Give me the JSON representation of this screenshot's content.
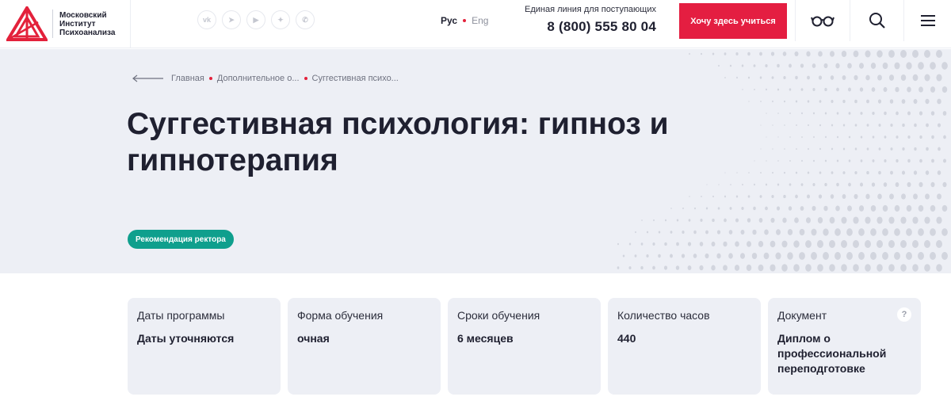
{
  "header": {
    "logo_lines": [
      "Московский",
      "Институт",
      "Психоанализа"
    ],
    "socials": [
      {
        "icon": "vk-icon",
        "glyph": "vk"
      },
      {
        "icon": "telegram-icon",
        "glyph": "➤"
      },
      {
        "icon": "youtube-icon",
        "glyph": "▶"
      },
      {
        "icon": "dzen-icon",
        "glyph": "✦"
      },
      {
        "icon": "whatsapp-icon",
        "glyph": "✆"
      }
    ],
    "lang_active": "Рус",
    "lang_inactive": "Eng",
    "phone_caption": "Единая линия для поступающих",
    "phone_number": "8 (800) 555 80 04",
    "cta_label": "Хочу здесь учиться",
    "accent_color": "#e41e41"
  },
  "hero": {
    "breadcrumb": [
      "Главная",
      "Дополнительное о...",
      "Суггестивная психо..."
    ],
    "title": "Суггестивная психология: гипноз и гипнотерапия",
    "badge": "Рекомендация ректора",
    "badge_color": "#0f9f8d"
  },
  "cards": [
    {
      "label": "Даты программы",
      "value": "Даты уточняются"
    },
    {
      "label": "Форма обучения",
      "value": "очная"
    },
    {
      "label": "Сроки обучения",
      "value": "6 месяцев"
    },
    {
      "label": "Количество часов",
      "value": "440"
    },
    {
      "label": "Документ",
      "value": "Диплом о профессиональной переподготовке",
      "help": "?"
    }
  ]
}
